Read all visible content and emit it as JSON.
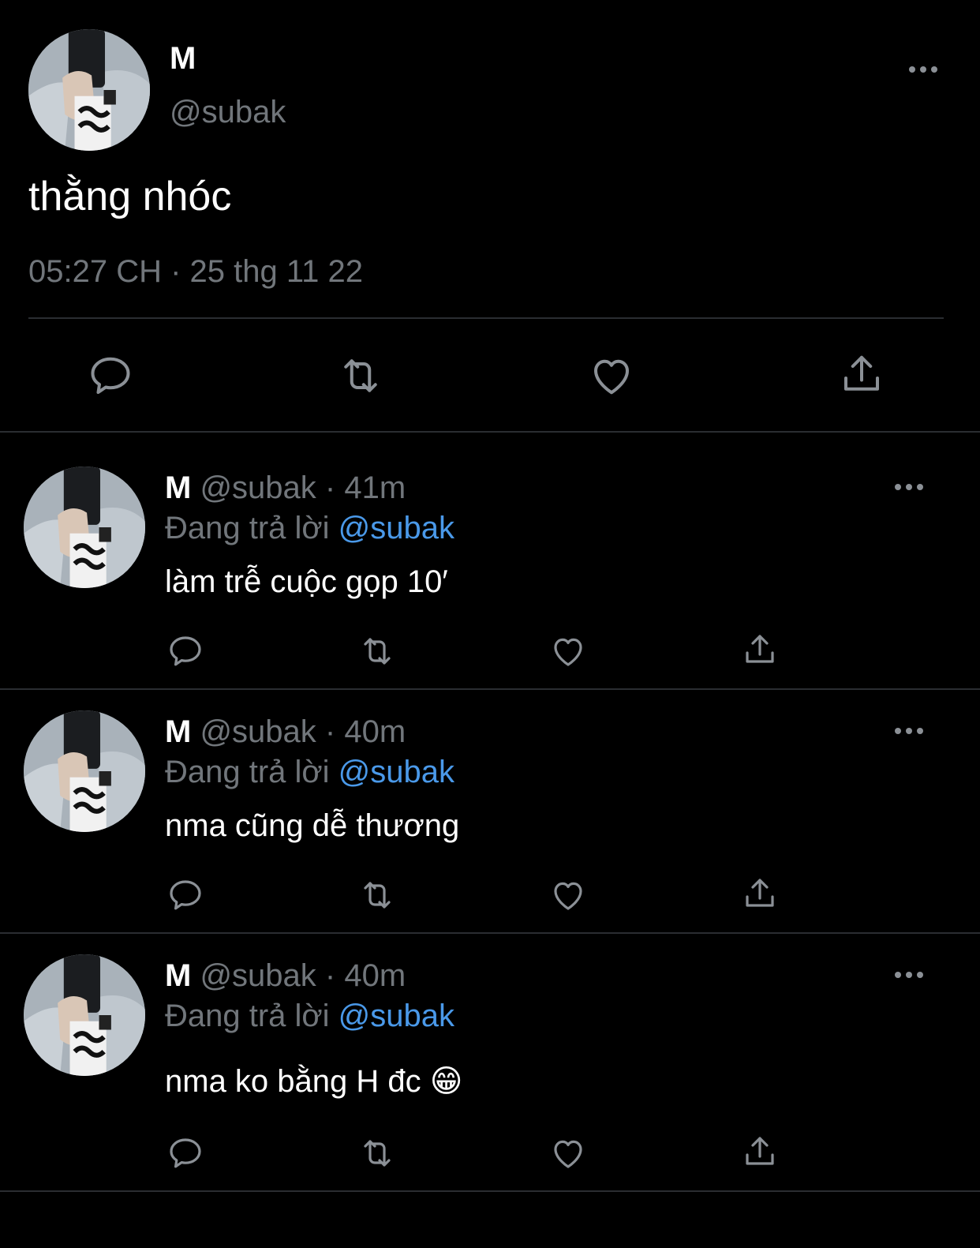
{
  "main_tweet": {
    "display_name": "M",
    "handle": "@subak",
    "text": "thằng nhóc",
    "timestamp": "05:27 CH · 25 thg 11 22"
  },
  "replies": [
    {
      "display_name": "M",
      "handle": "@subak",
      "time": "· 41m",
      "replying_prefix": "Đang trả lời",
      "replying_to": "@subak",
      "text": "làm trễ cuộc gọp 10′"
    },
    {
      "display_name": "M",
      "handle": "@subak",
      "time": "· 40m",
      "replying_prefix": "Đang trả lời",
      "replying_to": "@subak",
      "text": "nma cũng dễ thương"
    },
    {
      "display_name": "M",
      "handle": "@subak",
      "time": "· 40m",
      "replying_prefix": "Đang trả lời",
      "replying_to": "@subak",
      "text": "nma ko bằng H đc 😁"
    }
  ],
  "icons": [
    "reply-icon",
    "retweet-icon",
    "like-icon",
    "share-icon",
    "more-icon"
  ],
  "colors": {
    "background": "#000000",
    "secondary_text": "#71767b",
    "accent": "#4a99e9",
    "divider": "#2a2d31"
  }
}
